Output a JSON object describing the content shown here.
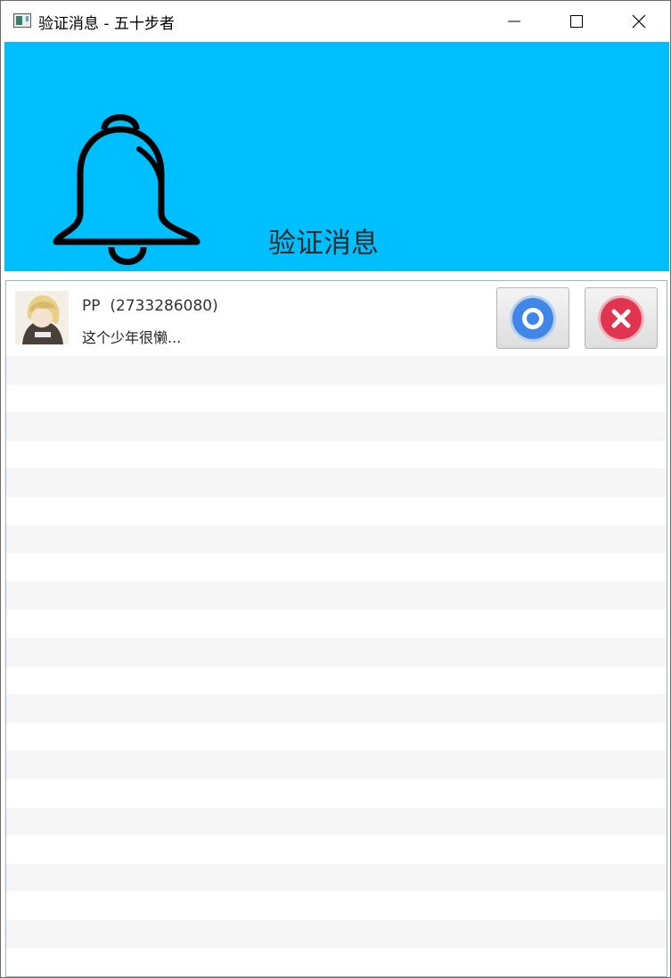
{
  "window": {
    "title": "验证消息 - 五十步者",
    "app_icon": "app-window-icon",
    "controls": [
      "minimize-icon",
      "maximize-icon",
      "close-icon"
    ]
  },
  "header": {
    "icon": "bell-icon",
    "title": "验证消息",
    "background": "#00bfff"
  },
  "requests": [
    {
      "name": "PP",
      "id": "(2733286080)",
      "message": "这个少年很懒...",
      "avatar": "avatar-image",
      "accept_icon": "accept-circle-icon",
      "reject_icon": "reject-x-icon"
    }
  ],
  "colors": {
    "accept": "#3f86e8",
    "reject": "#e0344f",
    "row_alt": "#f6f6f6"
  }
}
